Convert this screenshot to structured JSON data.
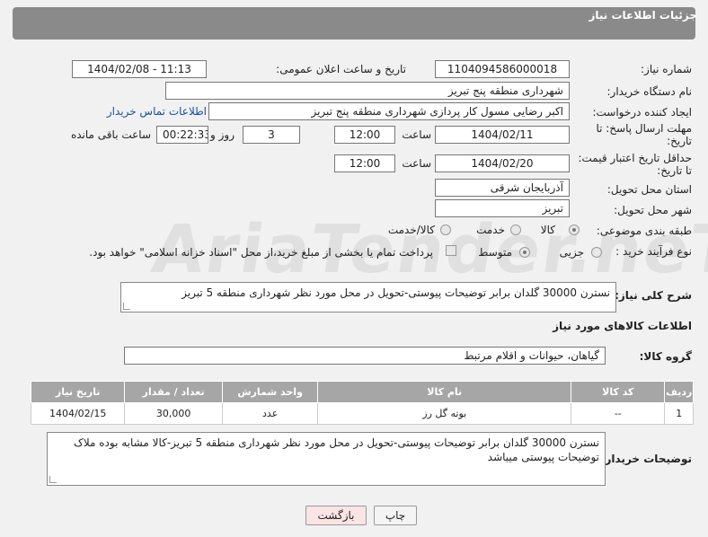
{
  "header": {
    "title": "جزئیات اطلاعات نیاز"
  },
  "form": {
    "need_number_label": "شماره نیاز:",
    "need_number": "1104094586000018",
    "announce_datetime_label": "تاریخ و ساعت اعلان عمومی:",
    "announce_datetime": "1404/02/08 - 11:13",
    "buyer_org_label": "نام دستگاه خریدار:",
    "buyer_org": "شهرداری منطقه پنج تبریز",
    "requester_label": "ایجاد کننده درخواست:",
    "requester": "اکبر رضایی مسول کار پردازی شهرداری منطقه پنج تبریز",
    "buyer_contact_link": "اطلاعات تماس خریدار",
    "reply_deadline_label_line1": "مهلت ارسال پاسخ: تا",
    "reply_deadline_label_line2": "تاریخ:",
    "reply_date": "1404/02/11",
    "time_label": "ساعت",
    "reply_time": "12:00",
    "days_value": "3",
    "days_label": "روز و",
    "remaining_time": "00:22:33",
    "remaining_label": "ساعت باقی مانده",
    "price_validity_label_line1": "حداقل تاریخ اعتبار قیمت:",
    "price_validity_label_line2": "تا تاریخ:",
    "price_date": "1404/02/20",
    "price_time": "12:00",
    "province_label": "استان محل تحویل:",
    "province": "آذربایجان شرقی",
    "city_label": "شهر محل تحویل:",
    "city": "تبریز",
    "category_label": "طبقه بندی موضوعی:",
    "category_options": [
      "کالا",
      "خدمت",
      "کالا/خدمت"
    ],
    "purchase_type_label": "نوع فرآیند خرید :",
    "purchase_type_options": [
      "جزیی",
      "متوسط"
    ],
    "payment_note": "پرداخت تمام یا بخشی از مبلغ خرید،از محل \"اسناد خزانه اسلامی\" خواهد بود.",
    "description_label": "شرح کلی نیاز:",
    "description": "نسترن 30000 گلدان برابر توضیحات پیوستی-تحویل در محل مورد نظر شهرداری منطقه 5 تبریز"
  },
  "goods": {
    "section_title": "اطلاعات کالاهای مورد نیاز",
    "group_label": "گروه کالا:",
    "group_value": "گیاهان، حیوانات و اقلام مرتبط",
    "table": {
      "headers": [
        "ردیف",
        "کد کالا",
        "نام کالا",
        "واحد شمارش",
        "تعداد / مقدار",
        "تاریخ نیاز"
      ],
      "rows": [
        [
          "1",
          "--",
          "بوته گل رز",
          "عدد",
          "30,000",
          "1404/02/15"
        ]
      ]
    },
    "buyer_notes_label": "توضیحات خریدار:",
    "buyer_notes": "نسترن 30000 گلدان برابر توضیحات پیوستی-تحویل در محل مورد نظر شهرداری منطقه 5 تبریز-کالا مشابه بوده ملاک توضیحات پیوستی میباشد"
  },
  "buttons": {
    "print": "چاپ",
    "back": "بازگشت"
  },
  "watermark": "AriaTender.neT",
  "colors": {
    "header_bg": "#8a8a8a",
    "table_header_bg": "#a6a6a6",
    "link": "#1a4fa0",
    "back_button_bg": "#fbe4e4"
  }
}
